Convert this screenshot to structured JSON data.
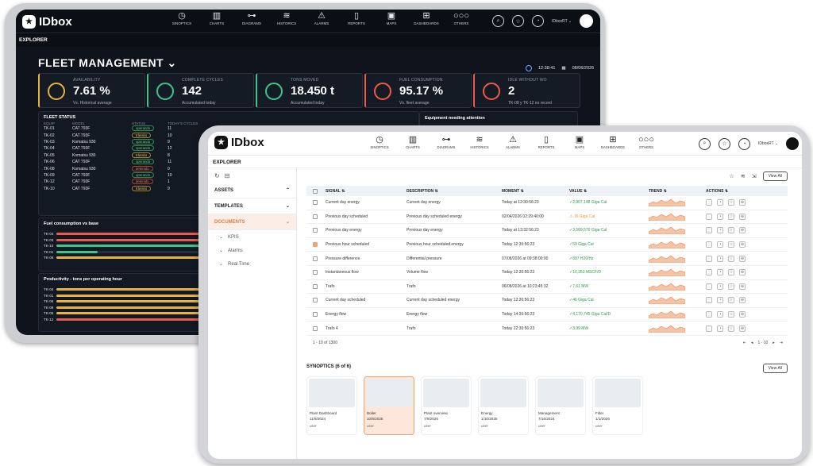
{
  "back": {
    "logo": "IDbox",
    "logo_mark": "★",
    "nav": [
      {
        "icon": "synoptics-icon",
        "glyph": "◷",
        "label": "SINOPTICS"
      },
      {
        "icon": "charts-icon",
        "glyph": "▥",
        "label": "CHARTS"
      },
      {
        "icon": "diagrams-icon",
        "glyph": "⊶",
        "label": "DIAGRAMS"
      },
      {
        "icon": "historics-icon",
        "glyph": "≋",
        "label": "HISTORICS"
      },
      {
        "icon": "alarms-icon",
        "glyph": "⚠",
        "label": "ALARMS"
      },
      {
        "icon": "reports-icon",
        "glyph": "▯",
        "label": "REPORTS"
      },
      {
        "icon": "maps-icon",
        "glyph": "▣",
        "label": "MAPS"
      },
      {
        "icon": "dashboards-icon",
        "glyph": "⊞",
        "label": "DASHBOARDS"
      },
      {
        "icon": "others-icon",
        "glyph": "○○○",
        "label": "OTHERS"
      }
    ],
    "user_label": "IDboxRT ⌄",
    "explorer": "EXPLORER",
    "title": "FLEET MANAGEMENT ⌄",
    "time": "12:38:41",
    "date": "08/06/2026",
    "kpis": [
      {
        "label": "AVAILABILITY",
        "value": "7.61 %",
        "sub": "Vs. Historical average",
        "color": "#e7b23a"
      },
      {
        "label": "COMPLETE CYCLES",
        "value": "142",
        "sub": "Accumulated today",
        "color": "#3cc48a"
      },
      {
        "label": "TONS MOVED",
        "value": "18.450 t",
        "sub": "Accumulated today",
        "color": "#3cc48a"
      },
      {
        "label": "FUEL CONSUMPTION",
        "value": "95.17 %",
        "sub": "Vs. fleet average",
        "color": "#ef5a48"
      },
      {
        "label": "IDLE WITHOUT WO",
        "value": "2",
        "sub": "TK-08 y TK-12",
        "sub2": "no record",
        "color": "#ef5a48"
      }
    ],
    "fleet_status": {
      "title": "FLEET STATUS",
      "headers": [
        "EQUIP",
        "MODEL",
        "STATUS",
        "TODAY'S CYCLES"
      ],
      "rows": [
        [
          "TK-01",
          "CAT 793F",
          "operando",
          "11"
        ],
        [
          "TK-02",
          "CAT 793F",
          "tránsito",
          "10"
        ],
        [
          "TK-03",
          "Komatsu 930",
          "operando",
          "9"
        ],
        [
          "TK-04",
          "CAT 793F",
          "operando",
          "12"
        ],
        [
          "TK-05",
          "Komatsu 930",
          "tránsito",
          "8"
        ],
        [
          "TK-06",
          "CAT 793F",
          "operando",
          "11"
        ],
        [
          "TK-08",
          "Komatsu 930",
          "detenido",
          "0"
        ],
        [
          "TK-09",
          "CAT 793F",
          "operando",
          "10"
        ],
        [
          "TK-12",
          "CAT 793F",
          "detenido",
          "1"
        ],
        [
          "TK-10",
          "CAT 793F",
          "tránsito",
          "9"
        ]
      ]
    },
    "attention_title": "Equipment needing attention",
    "fuel": {
      "title": "Fuel consumption vs base",
      "rows": [
        {
          "name": "TK-04",
          "value": 0.85,
          "color": "#e85b4c"
        },
        {
          "name": "TK-03",
          "value": 0.85,
          "color": "#e85b4c"
        },
        {
          "name": "TK-10",
          "value": 0.28,
          "color": "#3cc48a"
        },
        {
          "name": "TK-01",
          "value": 0.08,
          "color": "#3cc48a"
        },
        {
          "name": "TK-06",
          "value": 0.7,
          "color": "#e7b23a"
        }
      ]
    },
    "productivity": {
      "title": "Productivity - tons per operating hour",
      "rows": [
        {
          "name": "TK-04",
          "value": 0.95,
          "color": "#e7b23a"
        },
        {
          "name": "TK-01",
          "value": 0.95,
          "color": "#e7b23a"
        },
        {
          "name": "TK-06",
          "value": 0.95,
          "color": "#e7b23a"
        },
        {
          "name": "TK-09",
          "value": 0.95,
          "color": "#e7b23a"
        },
        {
          "name": "TK-05",
          "value": 0.95,
          "color": "#e7b23a"
        },
        {
          "name": "TK-12",
          "value": 0.4,
          "color": "#e85b4c"
        }
      ]
    }
  },
  "front": {
    "logo": "IDbox",
    "logo_mark": "★",
    "nav": [
      {
        "icon": "synoptics-icon",
        "glyph": "◷",
        "label": "SINOPTICS"
      },
      {
        "icon": "charts-icon",
        "glyph": "▥",
        "label": "CHARTS"
      },
      {
        "icon": "diagrams-icon",
        "glyph": "⊶",
        "label": "DIAGRAMS"
      },
      {
        "icon": "historics-icon",
        "glyph": "≋",
        "label": "HISTORICS"
      },
      {
        "icon": "alarms-icon",
        "glyph": "⚠",
        "label": "ALARMS"
      },
      {
        "icon": "reports-icon",
        "glyph": "▯",
        "label": "REPORTS"
      },
      {
        "icon": "maps-icon",
        "glyph": "▣",
        "label": "MAPS"
      },
      {
        "icon": "dashboards-icon",
        "glyph": "⊞",
        "label": "DASHBOARDS"
      },
      {
        "icon": "others-icon",
        "glyph": "○○○",
        "label": "OTHERS"
      }
    ],
    "user_label": "IDboxRT ⌄",
    "explorer": "EXPLORER",
    "sidebar": {
      "sections": [
        {
          "label": "ASSETS",
          "chev": "⌃",
          "active": false
        },
        {
          "label": "TEMPLATES",
          "chev": "⌄",
          "active": false
        },
        {
          "label": "DOCUMENTS",
          "chev": "⌄",
          "active": true
        }
      ],
      "items": [
        "KPIS",
        "Alarms",
        "Real Time"
      ]
    },
    "view_all": "View All",
    "table": {
      "headers": [
        "SIGNAL",
        "DESCRIPTION",
        "MOMENT",
        "VALUE",
        "TREND",
        "ACTIONS"
      ],
      "rows": [
        {
          "signal": "Current day energy",
          "desc": "Current day energy",
          "moment": "Today at 12:30:56:23",
          "value": "✓2,907,148 Giga Cal",
          "st": "ok",
          "checked": false
        },
        {
          "signal": "Previous day scheduled",
          "desc": "Previous day scheduled energy",
          "moment": "02/04/2026 02:29:40:00",
          "value": "⚠ 16 Giga Cal",
          "st": "warn",
          "checked": false
        },
        {
          "signal": "Previous day energy",
          "desc": "Previous day energy",
          "moment": "Today at 13:32:56:23",
          "value": "✓3,589,576 Giga Cal",
          "st": "ok",
          "checked": false
        },
        {
          "signal": "Previous hour scheduled",
          "desc": "Previous hour scheduled energy",
          "moment": "Today 12:30:56:23",
          "value": "✓59 Giga Cal",
          "st": "ok",
          "checked": true
        },
        {
          "signal": "Pressure difference",
          "desc": "Differential pressure",
          "moment": "07/08/2026 at 09:38:00:00",
          "value": "✓897 H20/Hz",
          "st": "ok",
          "checked": false
        },
        {
          "signal": "Instantaneous flow",
          "desc": "Volume flow",
          "moment": "Today 12:30:56:23",
          "value": "✓16,353 MSCF/D",
          "st": "ok",
          "checked": false
        },
        {
          "signal": "Trafo",
          "desc": "Trafo",
          "moment": "06/08/2026 at 10:23:45:32",
          "value": "✓7,61 MW",
          "st": "ok",
          "checked": false
        },
        {
          "signal": "Current day scheduled",
          "desc": "Current day scheduled energy",
          "moment": "Today 12:30:56:23",
          "value": "✓46 Giga Cal",
          "st": "ok",
          "checked": false
        },
        {
          "signal": "Energy flow",
          "desc": "Energy flow",
          "moment": "Today 14:30:56:23",
          "value": "✓4,170,745 Giga Cal/D",
          "st": "ok",
          "checked": false
        },
        {
          "signal": "Trafo 4",
          "desc": "Trafo",
          "moment": "Today 22:30:56:23",
          "value": "✓3,99 MW",
          "st": "ok",
          "checked": false
        }
      ],
      "pagination": "1 - 10 of 1300",
      "pager": "1 - 10"
    },
    "synoptics": {
      "title": "SYNOPTICS (6 of 6)",
      "cards": [
        {
          "name": "Plant Dashboard",
          "date": "11/9/2024",
          "user": "user",
          "active": false
        },
        {
          "name": "Boiler",
          "date": "10/8/2025",
          "user": "user",
          "active": true
        },
        {
          "name": "Plant overview",
          "date": "7/9/2026",
          "user": "user",
          "active": false
        },
        {
          "name": "Energy",
          "date": "1/10/2025",
          "user": "user",
          "active": false
        },
        {
          "name": "Management",
          "date": "7/16/2024",
          "user": "user",
          "active": false
        },
        {
          "name": "Filter",
          "date": "1/1/2026",
          "user": "user",
          "active": false
        }
      ]
    }
  }
}
